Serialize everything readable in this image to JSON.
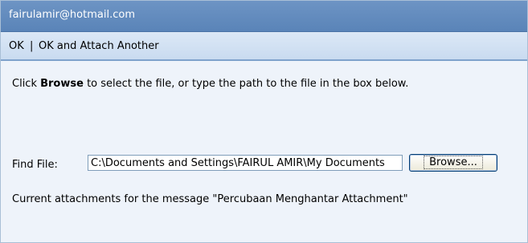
{
  "header": {
    "account": "fairulamir@hotmail.com"
  },
  "commands": {
    "ok_label": "OK",
    "separator": "|",
    "ok_attach_label": "OK and Attach Another"
  },
  "instructions": {
    "prefix": "Click ",
    "bold_word": "Browse",
    "suffix": " to select the file, or type the path to the file in the box below."
  },
  "find_file": {
    "label": "Find File:",
    "value": "C:\\Documents and Settings\\FAIRUL AMIR\\My Documents",
    "browse_label": "Browse..."
  },
  "attachments": {
    "text": "Current attachments for the message \"Percubaan Menghantar Attachment\""
  }
}
